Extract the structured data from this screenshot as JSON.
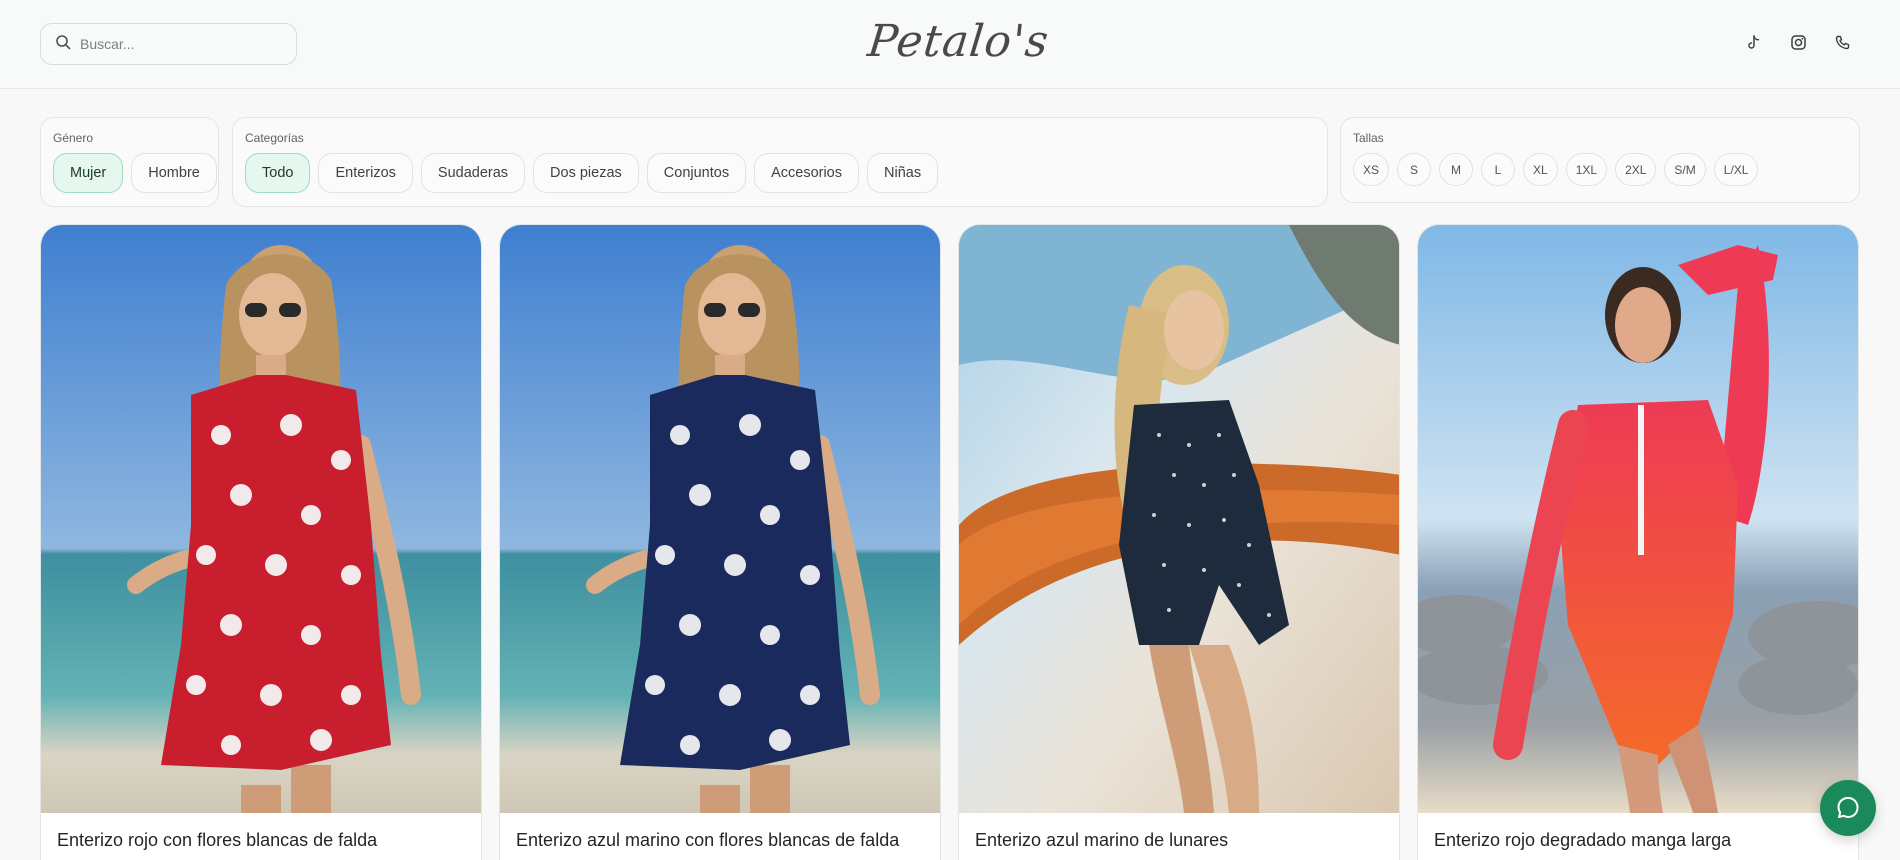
{
  "header": {
    "search_placeholder": "Buscar...",
    "logo_text": "Petalo's",
    "social_icons": [
      "tiktok-icon",
      "instagram-icon",
      "phone-icon"
    ]
  },
  "filters": {
    "gender": {
      "title": "Género",
      "options": [
        "Mujer",
        "Hombre"
      ],
      "selected": "Mujer"
    },
    "categories": {
      "title": "Categorías",
      "options": [
        "Todo",
        "Enterizos",
        "Sudaderas",
        "Dos piezas",
        "Conjuntos",
        "Accesorios",
        "Niñas"
      ],
      "selected": "Todo"
    },
    "sizes": {
      "title": "Tallas",
      "options": [
        "XS",
        "S",
        "M",
        "L",
        "XL",
        "1XL",
        "2XL",
        "S/M",
        "L/XL"
      ]
    }
  },
  "products": [
    {
      "title": "Enterizo rojo con flores blancas de falda",
      "swimsuit_color": "#c81e2e"
    },
    {
      "title": "Enterizo azul marino con flores blancas de falda",
      "swimsuit_color": "#1b2a5c"
    },
    {
      "title": "Enterizo azul marino de lunares",
      "swimsuit_color": "#1d2b3d"
    },
    {
      "title": "Enterizo rojo degradado manga larga",
      "swimsuit_color": "#ef3a3a"
    }
  ],
  "colors": {
    "accent": "#1a8a5a",
    "active_chip_bg": "#e6f7ef",
    "active_chip_border": "#9fdcbf"
  }
}
